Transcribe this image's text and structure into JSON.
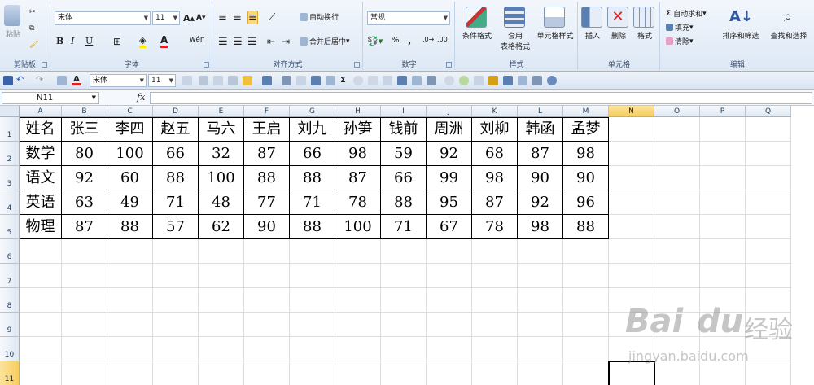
{
  "ribbon": {
    "clipboard": {
      "paste": "粘贴",
      "label": "剪贴板"
    },
    "font": {
      "name": "宋体",
      "size": "11",
      "label": "字体",
      "bold": "B",
      "italic": "I",
      "underline": "U",
      "grow": "A",
      "shrink": "A",
      "wen": "wén"
    },
    "alignment": {
      "wrap": "自动换行",
      "merge": "合并后居中",
      "label": "对齐方式"
    },
    "number": {
      "format": "常规",
      "percent": "%",
      "comma": ",",
      "label": "数字"
    },
    "styles": {
      "conditional": "条件格式",
      "table_line1": "套用",
      "table_line2": "表格格式",
      "cell_styles": "单元格样式",
      "label": "样式"
    },
    "cells": {
      "insert": "插入",
      "delete": "删除",
      "format": "格式",
      "label": "单元格"
    },
    "editing": {
      "autosum": "自动求和",
      "fill": "填充",
      "clear": "清除",
      "sort": "排序和筛选",
      "find": "查找和选择",
      "label": "编辑",
      "sigma": "Σ"
    }
  },
  "qat": {
    "font_name": "宋体",
    "font_size": "11"
  },
  "formula_bar": {
    "name_box": "N11",
    "fx": "fx",
    "formula": ""
  },
  "columns": [
    "A",
    "B",
    "C",
    "D",
    "E",
    "F",
    "G",
    "H",
    "I",
    "J",
    "K",
    "L",
    "M",
    "N",
    "O",
    "P",
    "Q"
  ],
  "rows": [
    "1",
    "2",
    "3",
    "4",
    "5",
    "6",
    "7",
    "8",
    "9",
    "10",
    "11"
  ],
  "selected": {
    "column": "N",
    "row": "11"
  },
  "table": [
    [
      "姓名",
      "张三",
      "李四",
      "赵五",
      "马六",
      "王启",
      "刘九",
      "孙笋",
      "钱前",
      "周洲",
      "刘柳",
      "韩函",
      "孟梦"
    ],
    [
      "数学",
      "80",
      "100",
      "66",
      "32",
      "87",
      "66",
      "98",
      "59",
      "92",
      "68",
      "87",
      "98"
    ],
    [
      "语文",
      "92",
      "60",
      "88",
      "100",
      "88",
      "88",
      "87",
      "66",
      "99",
      "98",
      "90",
      "90"
    ],
    [
      "英语",
      "63",
      "49",
      "71",
      "48",
      "77",
      "71",
      "78",
      "88",
      "95",
      "87",
      "92",
      "96"
    ],
    [
      "物理",
      "87",
      "88",
      "57",
      "62",
      "90",
      "88",
      "100",
      "71",
      "67",
      "78",
      "98",
      "88"
    ]
  ],
  "watermark": {
    "brand_a": "Bai",
    "brand_b": "du",
    "brand_cn": "经验",
    "url": "jingyan.baidu.com"
  },
  "colors": {
    "accent": "#f6cd5e",
    "ribbon": "#dde8f5",
    "grid": "#d8dfe8"
  }
}
